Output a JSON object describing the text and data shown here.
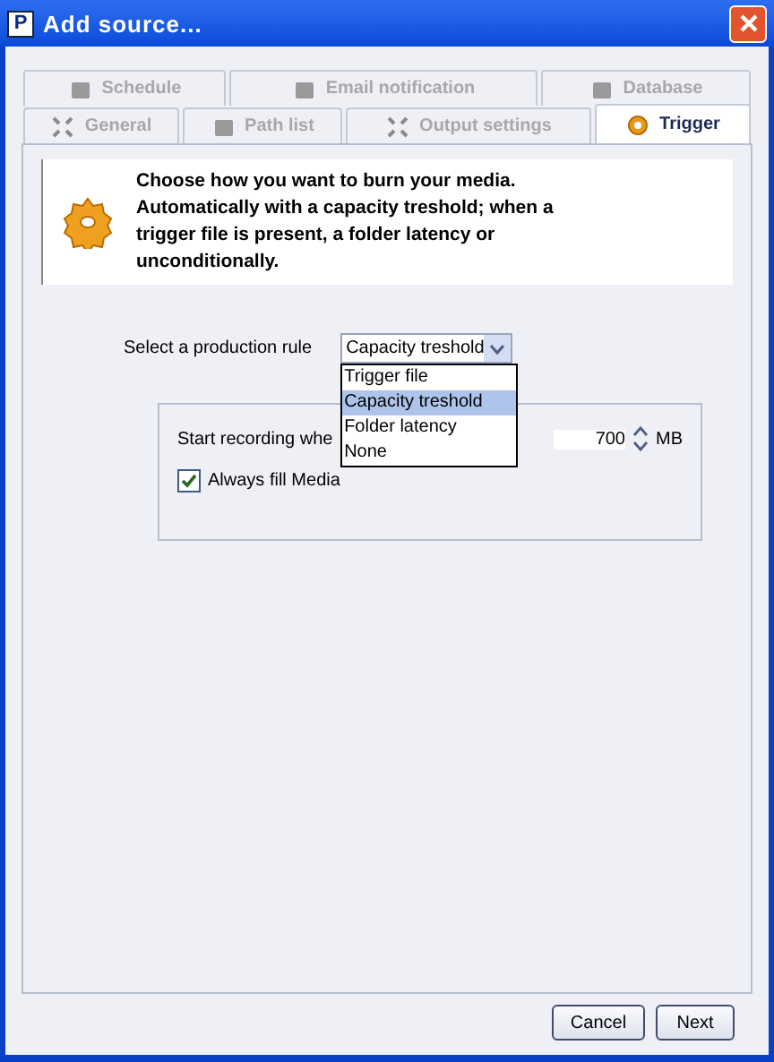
{
  "window": {
    "title": "Add source...",
    "app_icon": "P"
  },
  "tab_rows": [
    [
      {
        "label": "Schedule",
        "selected": false
      },
      {
        "label": "Email notification",
        "selected": false
      },
      {
        "label": "Database",
        "selected": false
      }
    ],
    [
      {
        "label": "General",
        "selected": false
      },
      {
        "label": "Path list",
        "selected": false
      },
      {
        "label": "Output settings",
        "selected": false
      },
      {
        "label": "Trigger",
        "selected": true
      }
    ]
  ],
  "info": "Choose how you want to burn your media. Automatically with a capacity treshold; when a trigger file is present, a folder latency or unconditionally.",
  "rule": {
    "label": "Select a production rule",
    "value": "Capacity treshold",
    "expanded": true,
    "options": [
      {
        "label": "Trigger file",
        "selected": false
      },
      {
        "label": "Capacity treshold",
        "selected": true
      },
      {
        "label": "Folder latency",
        "selected": false
      },
      {
        "label": "None",
        "selected": false
      }
    ]
  },
  "group": {
    "start_label": "Start recording whe",
    "value": "700",
    "unit": "MB",
    "fill": {
      "label": "Always fill Media",
      "checked": true
    }
  },
  "buttons": [
    "Cancel",
    "Next"
  ]
}
